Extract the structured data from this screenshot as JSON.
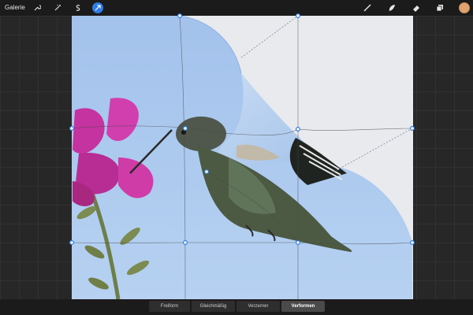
{
  "toolbar": {
    "gallery_label": "Galerie",
    "left_tools": [
      {
        "name": "wrench-icon"
      },
      {
        "name": "magic-wand-icon"
      },
      {
        "name": "selection-icon"
      },
      {
        "name": "transform-arrow-icon",
        "active": true
      }
    ],
    "right_tools": [
      {
        "name": "brush-icon"
      },
      {
        "name": "smudge-icon"
      },
      {
        "name": "eraser-icon"
      },
      {
        "name": "layers-icon"
      }
    ],
    "current_color": "#e0a370"
  },
  "transform_modes": [
    {
      "label": "Freiform",
      "active": false
    },
    {
      "label": "Gleichmäßig",
      "active": false
    },
    {
      "label": "Verzerren",
      "active": false
    },
    {
      "label": "Verformen",
      "active": true
    }
  ],
  "colors": {
    "accent": "#2f7de4",
    "sky": "#a9c9ef",
    "flower": "#c4339f"
  }
}
